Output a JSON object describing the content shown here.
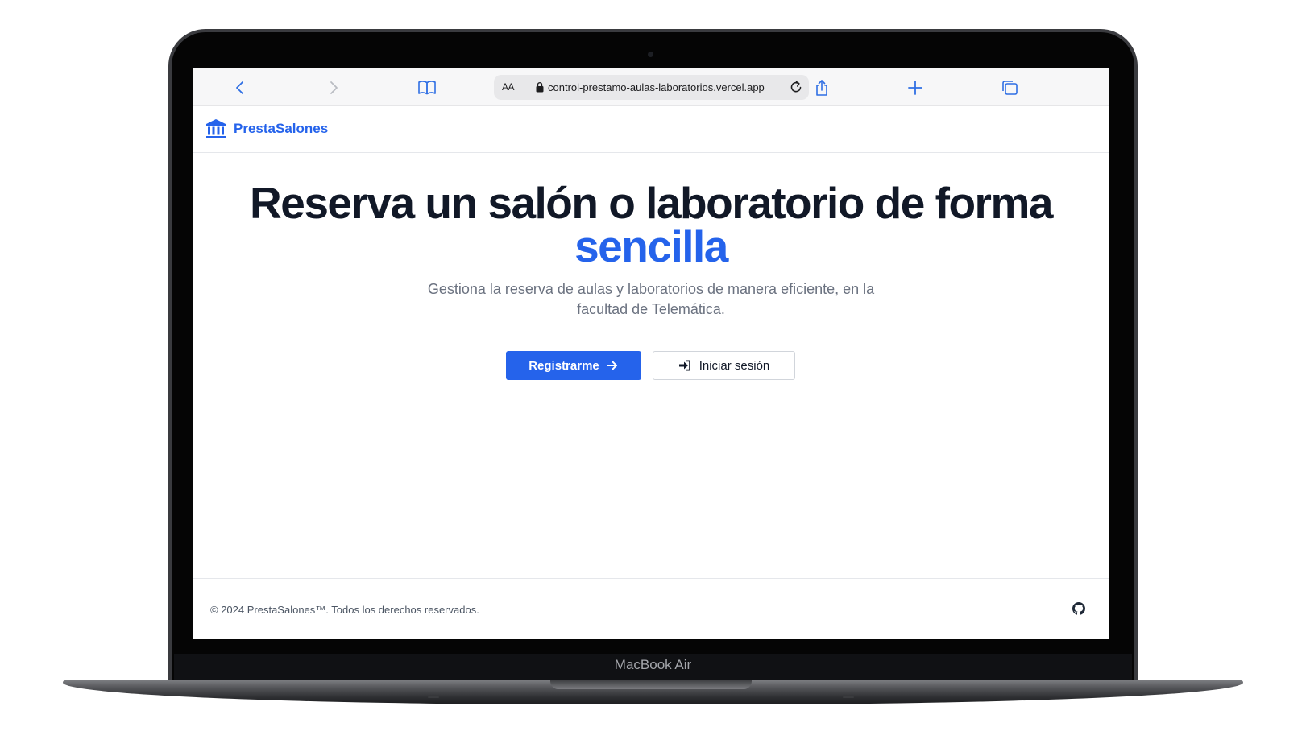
{
  "device": {
    "model_label": "MacBook Air"
  },
  "browser": {
    "text_size_label": "AA",
    "url": "control-prestamo-aulas-laboratorios.vercel.app",
    "icons": [
      "chevron-left-icon",
      "chevron-right-icon",
      "book-icon",
      "lock-icon",
      "reload-icon",
      "share-icon",
      "plus-icon",
      "tabs-icon"
    ]
  },
  "header": {
    "brand_name": "PrestaSalones",
    "brand_icon": "bank-building-icon"
  },
  "hero": {
    "title_main": "Reserva un salón o laboratorio de forma",
    "title_accent": "sencilla",
    "subtitle": "Gestiona la reserva de aulas y laboratorios de manera eficiente, en la facultad de Telemática.",
    "primary_button": "Registrarme",
    "secondary_button": "Iniciar sesión"
  },
  "footer": {
    "copyright": "© 2024 PrestaSalones™. Todos los derechos reservados.",
    "social_icon": "github-icon"
  },
  "colors": {
    "accent": "#2563eb",
    "title": "#111827",
    "muted": "#6b7280"
  }
}
